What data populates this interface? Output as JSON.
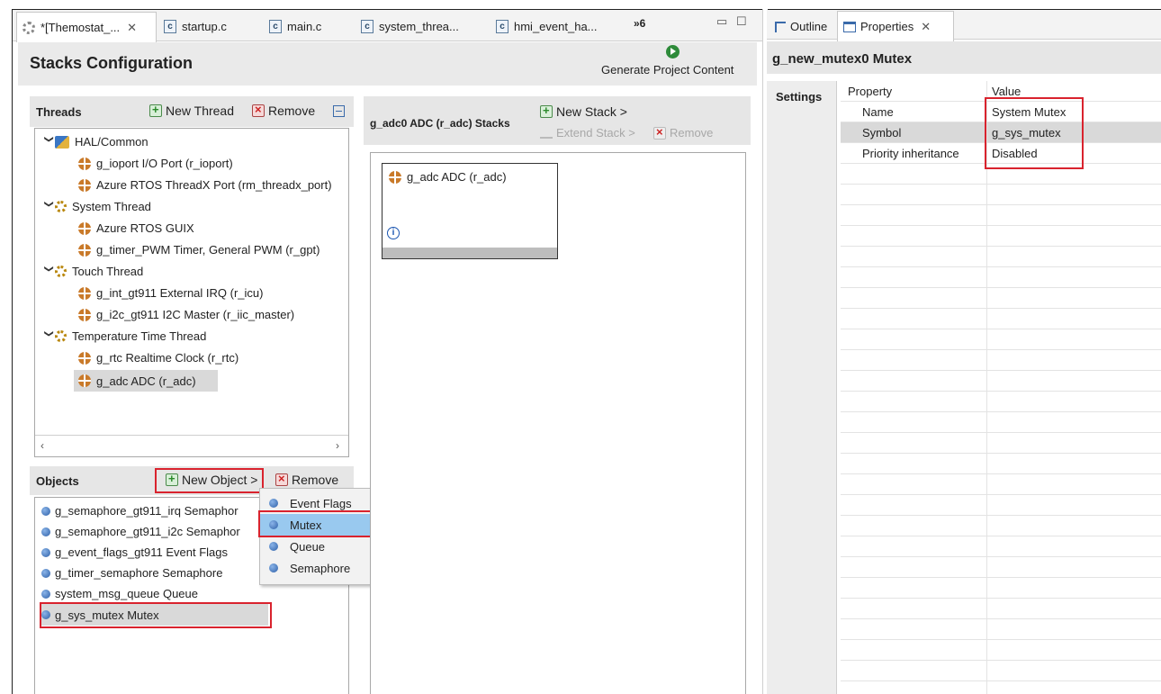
{
  "editor_tabs": [
    {
      "label": "*[Themostat_...",
      "active": true
    },
    {
      "label": "startup.c"
    },
    {
      "label": "main.c"
    },
    {
      "label": "system_threa..."
    },
    {
      "label": "hmi_event_ha..."
    }
  ],
  "overflow_count": "»6",
  "editor": {
    "title": "Stacks Configuration",
    "generate_label": "Generate Project Content"
  },
  "threads": {
    "title": "Threads",
    "new_thread": "New Thread",
    "remove": "Remove",
    "items": [
      "HAL/Common",
      "g_ioport I/O Port (r_ioport)",
      "Azure RTOS ThreadX Port (rm_threadx_port)",
      "System Thread",
      "Azure RTOS GUIX",
      "g_timer_PWM Timer, General PWM (r_gpt)",
      "Touch Thread",
      "g_int_gt911 External IRQ (r_icu)",
      "g_i2c_gt911 I2C Master (r_iic_master)",
      "Temperature Time Thread",
      "g_rtc Realtime Clock (r_rtc)",
      "g_adc ADC (r_adc)"
    ]
  },
  "objects": {
    "title": "Objects",
    "new_object": "New Object >",
    "remove": "Remove",
    "items": [
      "g_semaphore_gt911_irq Semaphor",
      "g_semaphore_gt911_i2c Semaphor",
      "g_event_flags_gt911 Event Flags",
      "g_timer_semaphore Semaphore",
      "system_msg_queue Queue",
      "g_sys_mutex Mutex"
    ]
  },
  "new_object_menu": [
    "Event Flags",
    "Mutex",
    "Queue",
    "Semaphore"
  ],
  "stacks": {
    "title": "g_adc0 ADC (r_adc) Stacks",
    "new_stack": "New Stack >",
    "extend_stack": "Extend Stack >",
    "remove": "Remove",
    "module_card": "g_adc ADC (r_adc)"
  },
  "right_tabs": {
    "outline": "Outline",
    "properties": "Properties"
  },
  "properties": {
    "title": "g_new_mutex0 Mutex",
    "settings_label": "Settings",
    "col_property": "Property",
    "col_value": "Value",
    "rows": [
      {
        "key": "Name",
        "value": "System Mutex"
      },
      {
        "key": "Symbol",
        "value": "g_sys_mutex"
      },
      {
        "key": "Priority inheritance",
        "value": "Disabled"
      }
    ]
  },
  "colors": {
    "highlight_box": "#d9232e",
    "menu_selected": "#99c9ef",
    "selection": "#d9d9d9"
  }
}
